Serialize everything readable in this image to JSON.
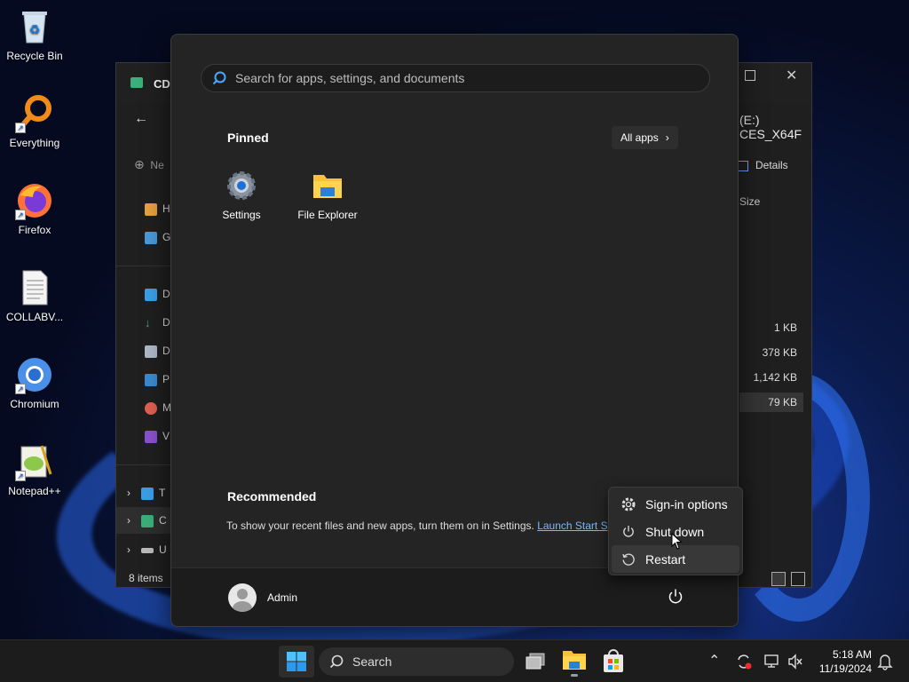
{
  "desktop": {
    "icons": [
      {
        "label": "Recycle Bin"
      },
      {
        "label": "Everything"
      },
      {
        "label": "Firefox"
      },
      {
        "label": "COLLABV..."
      },
      {
        "label": "Chromium"
      },
      {
        "label": "Notepad++"
      }
    ]
  },
  "explorer": {
    "tab_title": "CD",
    "address": "(E:) CES_X64F",
    "new_label": "Ne",
    "details_label": "Details",
    "col_size": "Size",
    "sizes": [
      "1 KB",
      "378 KB",
      "1,142 KB",
      "79 KB"
    ],
    "nav_letters": [
      "H",
      "G",
      "D",
      "D",
      "D",
      "P",
      "M",
      "V"
    ],
    "tree_letters": [
      "T",
      "C",
      "U"
    ],
    "status": "8 items"
  },
  "start_menu": {
    "search_placeholder": "Search for apps, settings, and documents",
    "pinned_title": "Pinned",
    "all_apps_label": "All apps",
    "pinned_apps": [
      {
        "label": "Settings"
      },
      {
        "label": "File Explorer"
      }
    ],
    "recommended_title": "Recommended",
    "recommended_text": "To show your recent files and new apps, turn them on in Settings.",
    "recommended_link": "Launch Start S",
    "user_name": "Admin"
  },
  "power_menu": {
    "items": [
      {
        "label": "Sign-in options"
      },
      {
        "label": "Shut down"
      },
      {
        "label": "Restart"
      }
    ]
  },
  "taskbar": {
    "search_label": "Search",
    "time": "5:18 AM",
    "date": "11/19/2024"
  },
  "colors": {
    "accent": "#0078d4",
    "link": "#7ab8ff",
    "start_bg": "#242424",
    "taskbar_bg": "#1c1c1c"
  }
}
